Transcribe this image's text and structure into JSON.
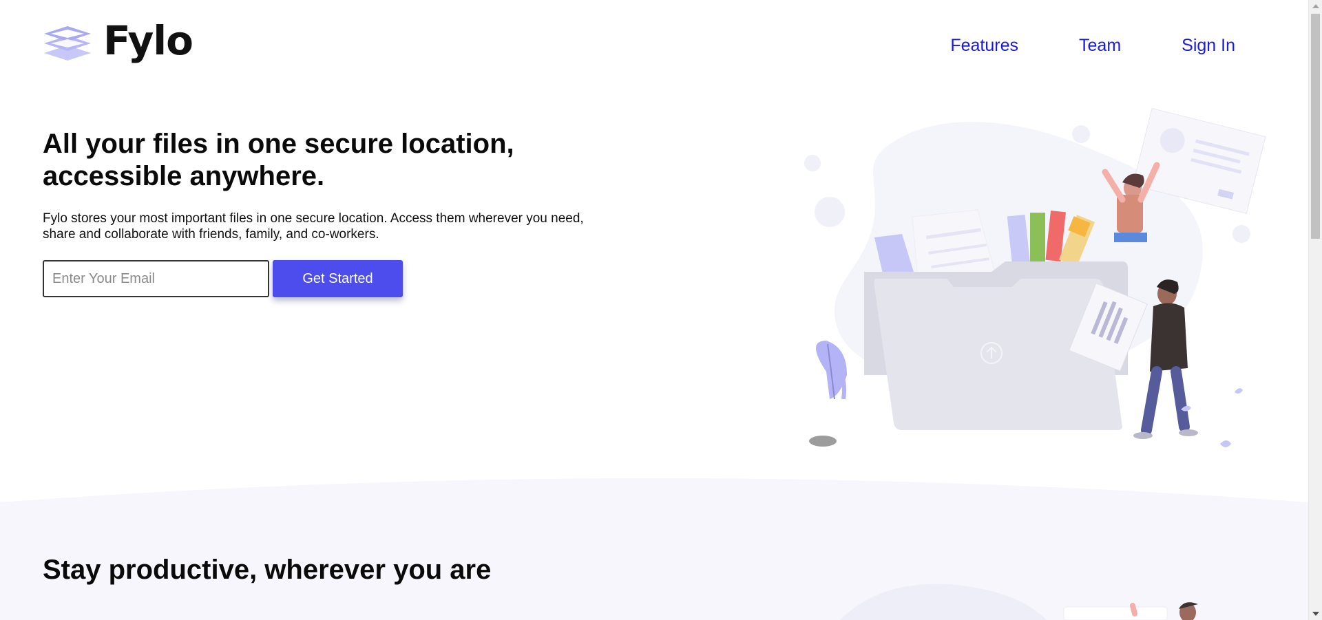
{
  "brand": {
    "name": "Fylo",
    "logo_icon": "stacked-layers-icon",
    "logo_color": "#b3b3f5"
  },
  "nav": {
    "items": [
      {
        "label": "Features"
      },
      {
        "label": "Team"
      },
      {
        "label": "Sign In"
      }
    ],
    "link_color": "#1b1bdc"
  },
  "hero": {
    "title": "All your files in one secure location, accessible anywhere.",
    "description": "Fylo stores your most important files in one secure location. Access them wherever you need, share and collaborate with friends, family, and co-workers.",
    "email_placeholder": "Enter Your Email",
    "email_value": "",
    "cta_label": "Get Started",
    "cta_color": "#4d4ced",
    "illustration": "folder-with-people-illustration"
  },
  "section2": {
    "title": "Stay productive, wherever you are",
    "illustration": "person-with-screen-illustration",
    "background_color": "#f6f6fc"
  },
  "scrollbar": {
    "icon_up": "scroll-up-arrow-icon",
    "icon_down": "scroll-down-arrow-icon"
  }
}
